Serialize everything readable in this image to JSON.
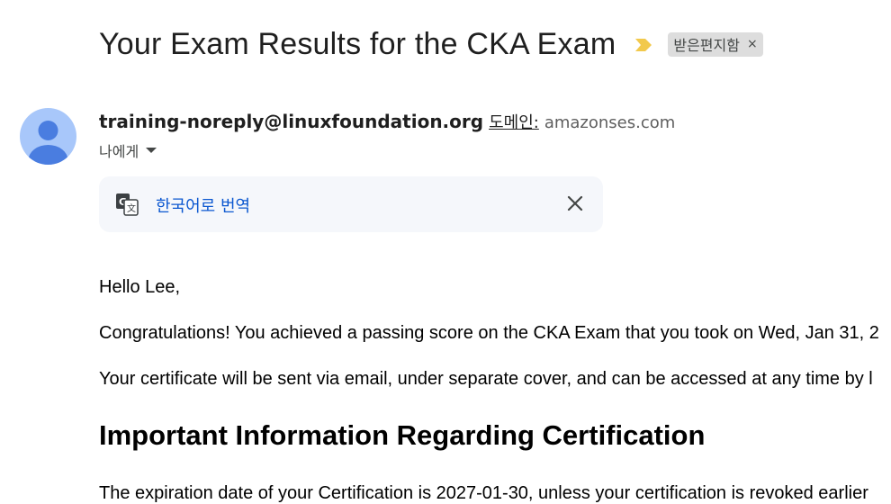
{
  "email": {
    "subject": "Your Exam Results for the CKA Exam",
    "label": "받은편지함",
    "label_remove": "×",
    "sender_email": "training-noreply@linuxfoundation.org",
    "via_label": "도메인:",
    "via_domain": "amazonses.com",
    "to_label": "나에게",
    "translate_label": "한국어로 번역"
  },
  "body": {
    "greeting": "Hello Lee,",
    "paragraph1": "Congratulations! You achieved a passing score on the CKA Exam that you took on Wed, Jan 31, 2",
    "paragraph2": "Your certificate will be sent via email, under separate cover, and can be accessed at any time by l",
    "heading": "Important Information Regarding Certification",
    "paragraph3": "The expiration date of your Certification is 2027-01-30, unless your certification is revoked earlier"
  },
  "colors": {
    "importance_marker": "#f2c94c",
    "link": "#0b57d0",
    "avatar_bg": "#a8c7fa",
    "avatar_fg": "#4a7de0"
  }
}
